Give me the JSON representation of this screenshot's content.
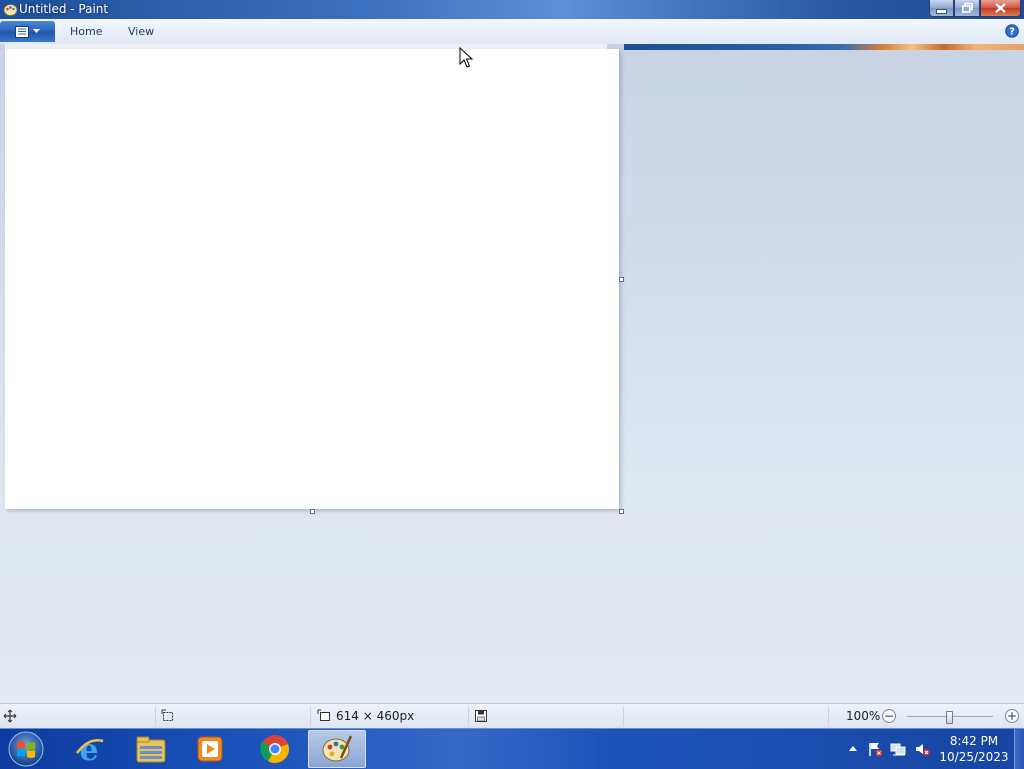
{
  "window": {
    "title": "Untitled - Paint",
    "controls": {
      "minimize": "minimize",
      "maximize": "restore",
      "close": "close"
    }
  },
  "ribbon": {
    "tabs": [
      {
        "label": "Home"
      },
      {
        "label": "View"
      }
    ],
    "app_menu_icon": "paint-menu-icon",
    "help_icon": "help-icon"
  },
  "canvas": {
    "background": "#ffffff"
  },
  "statusbar": {
    "dimensions": "614 × 460px",
    "zoom": "100%",
    "zoom_fraction": 0.5
  },
  "taskbar": {
    "items": [
      {
        "name": "internet-explorer",
        "icon": "ie-icon"
      },
      {
        "name": "windows-explorer",
        "icon": "folder-icon"
      },
      {
        "name": "media-player",
        "icon": "media-player-icon"
      },
      {
        "name": "google-chrome",
        "icon": "chrome-icon"
      },
      {
        "name": "paint",
        "icon": "paint-icon",
        "active": true
      }
    ],
    "clock": {
      "time": "8:42 PM",
      "date": "10/25/2023"
    }
  },
  "colors": {
    "titlebar": "#2a5ba8",
    "taskbar": "#1b53bb",
    "workspace": "#dde5f0"
  }
}
